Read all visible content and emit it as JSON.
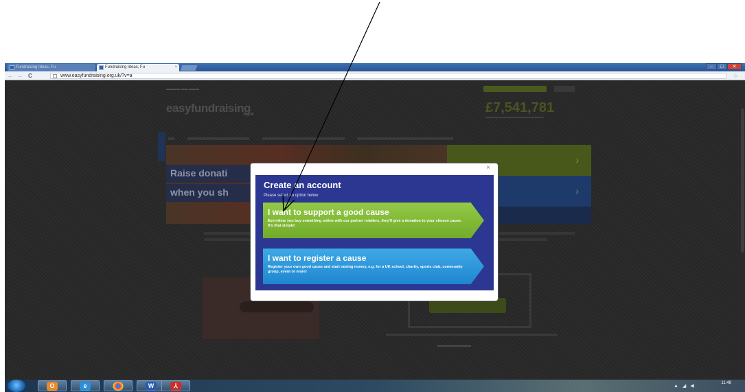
{
  "browser": {
    "tabs": [
      {
        "label": "Fundraising Ideas, Fu",
        "active": false
      },
      {
        "label": "Fundraising Ideas, Fu",
        "active": true
      }
    ],
    "url": "www.easyfundraising.org.uk/?v=a",
    "nav_back": "←",
    "nav_forward": "→",
    "nav_reload": "C",
    "star": "☆",
    "window_controls": {
      "minimize": "–",
      "maximize": "□",
      "close": "✕"
    }
  },
  "page": {
    "logo": "easyfundraising",
    "logo_suffix": "org.uk",
    "total": "£7,541,781",
    "banner_line1": "Raise donati",
    "banner_line2": "when you sh"
  },
  "modal": {
    "close": "×",
    "title": "Create an account",
    "subtitle": "Please select an option below",
    "options": [
      {
        "heading": "I want to support a good cause",
        "description": "Everytime you buy something online with our partner retailers, they'll give a donation to your chosen cause. It's that simple!",
        "color": "#7fbb35"
      },
      {
        "heading": "I want to register a cause",
        "description": "Register your own good cause and start raising money, e.g. for a UK school, charity, sports club, community group, event or more!",
        "color": "#2a95dc"
      }
    ]
  },
  "taskbar": {
    "time": "11:48",
    "apps": [
      "start-orb",
      "outlook",
      "internet-explorer",
      "chrome",
      "word",
      "acrobat"
    ]
  },
  "colors": {
    "modal_panel": "#2b3790",
    "overlay": "#2a2a2a",
    "arrow": "#000000"
  }
}
